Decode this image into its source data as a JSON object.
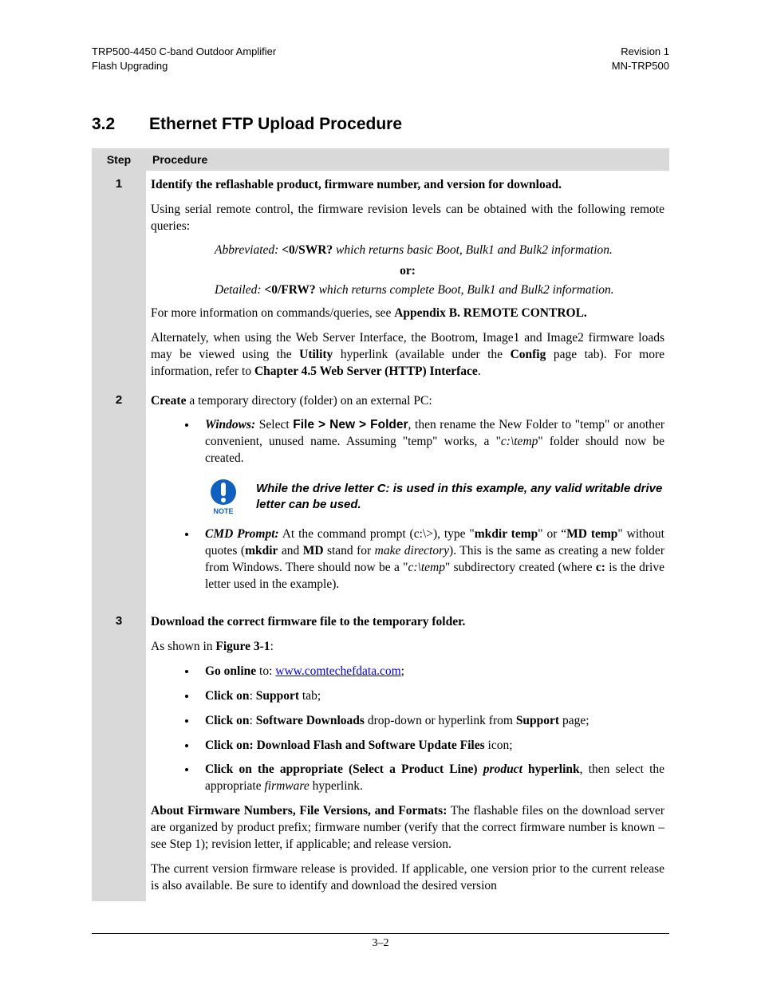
{
  "header": {
    "left1": "TRP500-4450 C-band Outdoor Amplifier",
    "left2": "Flash Upgrading",
    "right1": "Revision 1",
    "right2": "MN-TRP500"
  },
  "heading": {
    "num": "3.2",
    "title": "Ethernet FTP Upload Procedure"
  },
  "table": {
    "th_step": "Step",
    "th_proc": "Procedure",
    "step1": {
      "num": "1",
      "title": "Identify the reflashable product, firmware number, and version for download.",
      "p1": "Using serial remote control, the firmware revision levels can be obtained with the following remote queries:",
      "abbrev_lead": "Abbreviated: ",
      "abbrev_cmd": "<0/SWR?",
      "abbrev_tail": " which returns basic Boot, Bulk1 and Bulk2 information.",
      "or": "or:",
      "detail_lead": "Detailed: ",
      "detail_cmd": "<0/FRW?",
      "detail_tail": " which returns complete Boot, Bulk1 and Bulk2 information.",
      "p2a": "For more information on commands/queries, see ",
      "p2b": "Appendix B. REMOTE CONTROL.",
      "p3a": "Alternately, when using the Web Server Interface, the Bootrom, Image1 and Image2 firmware loads may be viewed using the ",
      "p3b": "Utility",
      "p3c": " hyperlink (available under the ",
      "p3d": "Config",
      "p3e": " page tab). For more information, refer to ",
      "p3f": "Chapter 4.5 Web Server (HTTP) Interface",
      "p3g": "."
    },
    "step2": {
      "num": "2",
      "lead_b": "Create",
      "lead_t": " a temporary directory (folder) on an external PC:",
      "li1_a": "Windows:",
      "li1_b": " Select ",
      "li1_c": "File > New > Folder",
      "li1_d": ", then rename the New Folder to \"temp\" or another convenient, unused name. Assuming \"temp\" works, a \"",
      "li1_e": "c:\\temp",
      "li1_f": "\" folder should now be created.",
      "note_label": "NOTE",
      "note": "While the drive letter C: is used in this example, any valid writable drive letter can be used.",
      "li2_a": "CMD Prompt:",
      "li2_b": " At the command prompt (c:\\>), type \"",
      "li2_c": "mkdir temp",
      "li2_d": "\" or “",
      "li2_e": "MD temp",
      "li2_f": "\" without quotes (",
      "li2_g": "mkdir",
      "li2_h": " and ",
      "li2_i": "MD",
      "li2_j": " stand for ",
      "li2_k": "make directory",
      "li2_l": "). This is the same as creating a new folder from Windows. There should now be a \"",
      "li2_m": "c:\\temp",
      "li2_n": "\" subdirectory created (where ",
      "li2_o": "c:",
      "li2_p": " is the drive letter used in the example)."
    },
    "step3": {
      "num": "3",
      "title": "Download the correct firmware file to the temporary folder.",
      "p1a": "As shown in ",
      "p1b": "Figure 3-1",
      "p1c": ":",
      "li1_a": "Go online",
      "li1_b": " to: ",
      "li1_link": "www.comtechefdata.com",
      "li1_c": ";",
      "li2_a": "Click on",
      "li2_b": ": ",
      "li2_c": "Support",
      "li2_d": " tab;",
      "li3_a": "Click on",
      "li3_b": ": ",
      "li3_c": "Software Downloads",
      "li3_d": " drop-down or hyperlink from ",
      "li3_e": "Support",
      "li3_f": " page;",
      "li4_a": "Click on: Download Flash and Software Update Files",
      "li4_b": " icon;",
      "li5_a": "Click on the appropriate (Select a Product Line) ",
      "li5_b": "product",
      "li5_c": " hyperlink",
      "li5_d": ", then select the appropriate ",
      "li5_e": "firmware",
      "li5_f": " hyperlink.",
      "p2a": "About Firmware Numbers, File Versions, and Formats:",
      "p2b": " The flashable files on the download server are organized by product prefix; firmware number (verify that the correct firmware number is known – see Step 1); revision letter, if applicable; and release version.",
      "p3": "The current version firmware release is provided. If applicable, one version prior to the current release is also available. Be sure to identify and download the desired version"
    }
  },
  "footer": "3–2"
}
